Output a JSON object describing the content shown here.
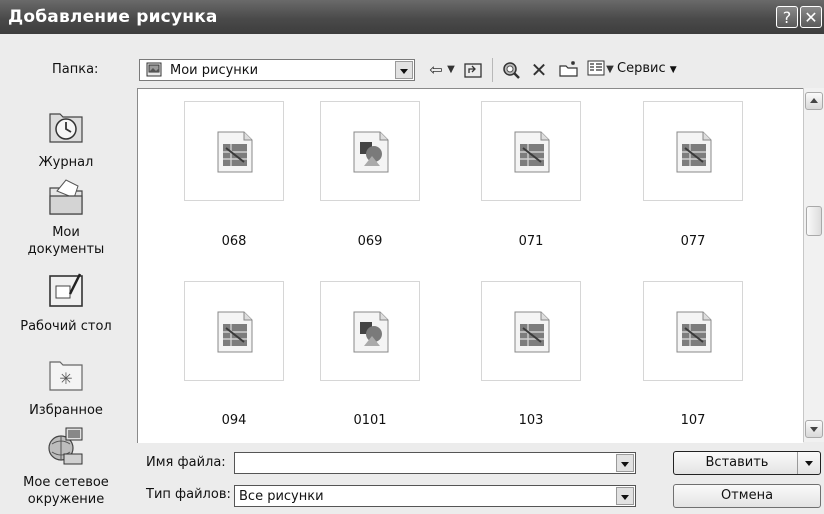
{
  "window": {
    "title": "Добавление рисунка",
    "help_glyph": "?",
    "close_glyph": "✕"
  },
  "toolbar": {
    "folder_label": "Папка:",
    "folder_value": "Мои рисунки",
    "tools_label": "Сервис"
  },
  "places": [
    {
      "label": "Журнал",
      "icon": "history-icon"
    },
    {
      "label": "Мои документы",
      "icon": "my-documents-icon"
    },
    {
      "label": "Рабочий стол",
      "icon": "desktop-icon"
    },
    {
      "label": "Избранное",
      "icon": "favorites-icon"
    },
    {
      "label": "Мое сетевое окружение",
      "icon": "network-places-icon"
    }
  ],
  "files": [
    {
      "name": "068",
      "type": "image"
    },
    {
      "name": "069",
      "type": "clipart"
    },
    {
      "name": "071",
      "type": "image"
    },
    {
      "name": "077",
      "type": "image"
    },
    {
      "name": "094",
      "type": "image"
    },
    {
      "name": "0101",
      "type": "clipart"
    },
    {
      "name": "103",
      "type": "image"
    },
    {
      "name": "107",
      "type": "image"
    }
  ],
  "bottom": {
    "filename_label": "Имя файла:",
    "filename_value": "",
    "filetype_label": "Тип файлов:",
    "filetype_value": "Все рисунки",
    "insert_button": "Вставить",
    "cancel_button": "Отмена"
  }
}
